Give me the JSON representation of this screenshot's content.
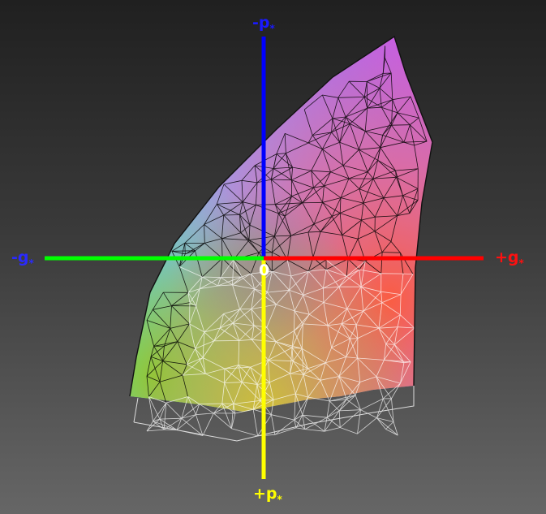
{
  "axes": {
    "neg_p": {
      "text": "-p",
      "sub": "*",
      "color": "#1a1aff"
    },
    "pos_p": {
      "text": "+p",
      "sub": "*",
      "color": "#ffff00"
    },
    "neg_g": {
      "text": "-g",
      "sub": "*",
      "color": "#2a2aff"
    },
    "pos_g": {
      "text": "+g",
      "sub": "*",
      "color": "#ff1010"
    },
    "origin": "0"
  },
  "colors": {
    "neg_p_axis": "#0000ff",
    "pos_p_axis": "#ffff00",
    "neg_g_axis": "#00ff00",
    "pos_g_axis": "#ff0000",
    "wire_dark": "#000000",
    "wire_light": "#ffffff"
  }
}
